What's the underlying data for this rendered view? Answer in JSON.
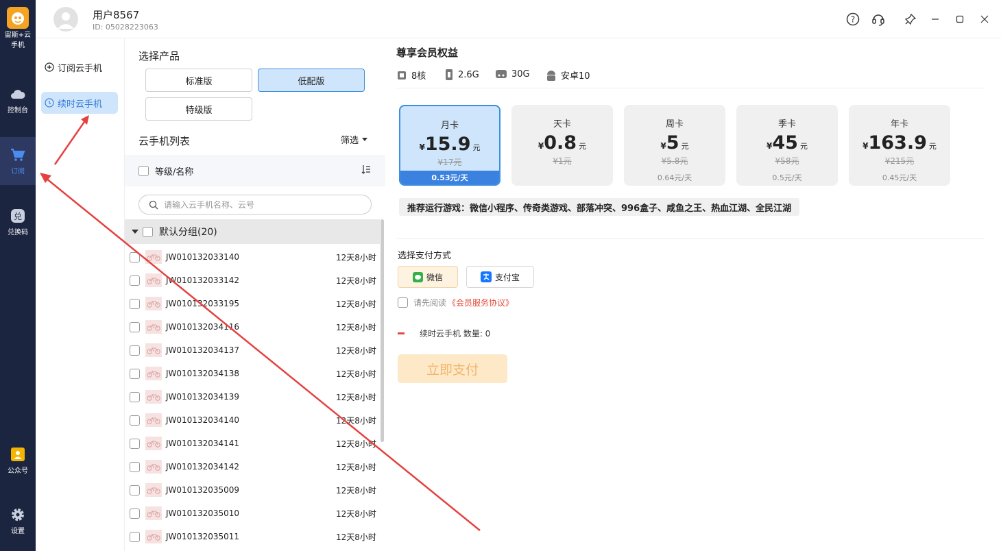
{
  "nav": {
    "logo_label": "宙斯+云手机",
    "console": "控制台",
    "subscribe": "订阅",
    "redeem": "兑换码",
    "official": "公众号",
    "settings": "设置"
  },
  "header": {
    "username": "用户8567",
    "user_id": "ID: 05028223063"
  },
  "side": {
    "subscribe_phone": "订阅云手机",
    "renew_phone": "续时云手机"
  },
  "product": {
    "title": "选择产品",
    "options": [
      "标准版",
      "低配版",
      "特级版"
    ],
    "selected": "低配版"
  },
  "list": {
    "title": "云手机列表",
    "filter": "筛选",
    "header": "等级/名称",
    "search_placeholder": "请输入云手机名称、云号",
    "group": "默认分组(20)",
    "items": [
      {
        "name": "JW010132033140",
        "duration": "12天8小时"
      },
      {
        "name": "JW010132033142",
        "duration": "12天8小时"
      },
      {
        "name": "JW010132033195",
        "duration": "12天8小时"
      },
      {
        "name": "JW010132034116",
        "duration": "12天8小时"
      },
      {
        "name": "JW010132034137",
        "duration": "12天8小时"
      },
      {
        "name": "JW010132034138",
        "duration": "12天8小时"
      },
      {
        "name": "JW010132034139",
        "duration": "12天8小时"
      },
      {
        "name": "JW010132034140",
        "duration": "12天8小时"
      },
      {
        "name": "JW010132034141",
        "duration": "12天8小时"
      },
      {
        "name": "JW010132034142",
        "duration": "12天8小时"
      },
      {
        "name": "JW010132035009",
        "duration": "12天8小时"
      },
      {
        "name": "JW010132035010",
        "duration": "12天8小时"
      },
      {
        "name": "JW010132035011",
        "duration": "12天8小时"
      }
    ]
  },
  "benefits": {
    "title": "尊享会员权益",
    "specs": [
      "8核",
      "2.6G",
      "30G",
      "安卓10"
    ]
  },
  "plans": [
    {
      "name": "月卡",
      "currency": "¥",
      "price": "15.9",
      "unit": "元",
      "original": "¥17元",
      "daily": "0.53元/天"
    },
    {
      "name": "天卡",
      "currency": "¥",
      "price": "0.8",
      "unit": "元",
      "original": "¥1元",
      "daily": ""
    },
    {
      "name": "周卡",
      "currency": "¥",
      "price": "5",
      "unit": "元",
      "original": "¥5.8元",
      "daily": "0.64元/天"
    },
    {
      "name": "季卡",
      "currency": "¥",
      "price": "45",
      "unit": "元",
      "original": "¥58元",
      "daily": "0.5元/天"
    },
    {
      "name": "年卡",
      "currency": "¥",
      "price": "163.9",
      "unit": "元",
      "original": "¥215元",
      "daily": "0.45元/天"
    }
  ],
  "games": "推荐运行游戏：微信小程序、传奇类游戏、部落冲突、996盒子、咸鱼之王、热血江湖、全民江湖",
  "payment": {
    "title": "选择支付方式",
    "wechat": "微信",
    "alipay": "支付宝",
    "agree_prefix": "请先阅读",
    "agree_link": "《会员服务协议》",
    "quantity": "续时云手机 数量: 0",
    "pay_button": "立即支付"
  },
  "colors": {
    "nav_bg": "#1c2540",
    "accent_blue": "#3b82e0",
    "selected_bg": "#cfe5fb",
    "arrow_red": "#e5413f",
    "pay_button_bg": "#fde9c8"
  }
}
